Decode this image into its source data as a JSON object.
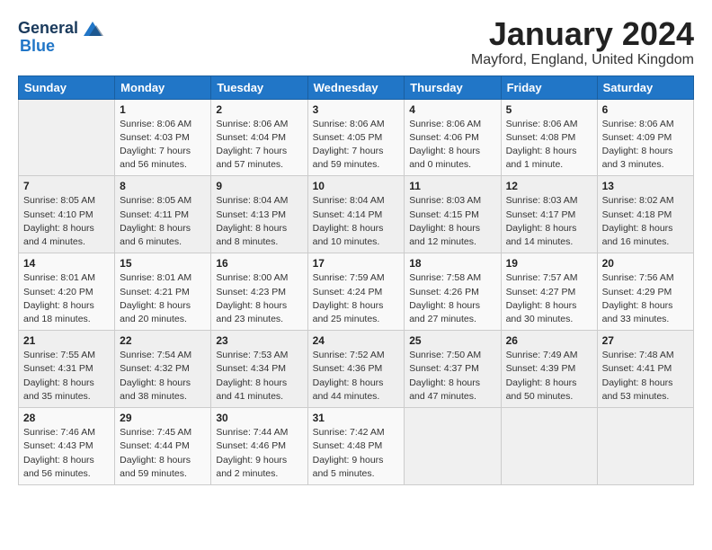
{
  "logo": {
    "general": "General",
    "blue": "Blue"
  },
  "header": {
    "title": "January 2024",
    "subtitle": "Mayford, England, United Kingdom"
  },
  "weekdays": [
    "Sunday",
    "Monday",
    "Tuesday",
    "Wednesday",
    "Thursday",
    "Friday",
    "Saturday"
  ],
  "weeks": [
    [
      {
        "day": "",
        "sunrise": "",
        "sunset": "",
        "daylight": ""
      },
      {
        "day": "1",
        "sunrise": "Sunrise: 8:06 AM",
        "sunset": "Sunset: 4:03 PM",
        "daylight": "Daylight: 7 hours and 56 minutes."
      },
      {
        "day": "2",
        "sunrise": "Sunrise: 8:06 AM",
        "sunset": "Sunset: 4:04 PM",
        "daylight": "Daylight: 7 hours and 57 minutes."
      },
      {
        "day": "3",
        "sunrise": "Sunrise: 8:06 AM",
        "sunset": "Sunset: 4:05 PM",
        "daylight": "Daylight: 7 hours and 59 minutes."
      },
      {
        "day": "4",
        "sunrise": "Sunrise: 8:06 AM",
        "sunset": "Sunset: 4:06 PM",
        "daylight": "Daylight: 8 hours and 0 minutes."
      },
      {
        "day": "5",
        "sunrise": "Sunrise: 8:06 AM",
        "sunset": "Sunset: 4:08 PM",
        "daylight": "Daylight: 8 hours and 1 minute."
      },
      {
        "day": "6",
        "sunrise": "Sunrise: 8:06 AM",
        "sunset": "Sunset: 4:09 PM",
        "daylight": "Daylight: 8 hours and 3 minutes."
      }
    ],
    [
      {
        "day": "7",
        "sunrise": "Sunrise: 8:05 AM",
        "sunset": "Sunset: 4:10 PM",
        "daylight": "Daylight: 8 hours and 4 minutes."
      },
      {
        "day": "8",
        "sunrise": "Sunrise: 8:05 AM",
        "sunset": "Sunset: 4:11 PM",
        "daylight": "Daylight: 8 hours and 6 minutes."
      },
      {
        "day": "9",
        "sunrise": "Sunrise: 8:04 AM",
        "sunset": "Sunset: 4:13 PM",
        "daylight": "Daylight: 8 hours and 8 minutes."
      },
      {
        "day": "10",
        "sunrise": "Sunrise: 8:04 AM",
        "sunset": "Sunset: 4:14 PM",
        "daylight": "Daylight: 8 hours and 10 minutes."
      },
      {
        "day": "11",
        "sunrise": "Sunrise: 8:03 AM",
        "sunset": "Sunset: 4:15 PM",
        "daylight": "Daylight: 8 hours and 12 minutes."
      },
      {
        "day": "12",
        "sunrise": "Sunrise: 8:03 AM",
        "sunset": "Sunset: 4:17 PM",
        "daylight": "Daylight: 8 hours and 14 minutes."
      },
      {
        "day": "13",
        "sunrise": "Sunrise: 8:02 AM",
        "sunset": "Sunset: 4:18 PM",
        "daylight": "Daylight: 8 hours and 16 minutes."
      }
    ],
    [
      {
        "day": "14",
        "sunrise": "Sunrise: 8:01 AM",
        "sunset": "Sunset: 4:20 PM",
        "daylight": "Daylight: 8 hours and 18 minutes."
      },
      {
        "day": "15",
        "sunrise": "Sunrise: 8:01 AM",
        "sunset": "Sunset: 4:21 PM",
        "daylight": "Daylight: 8 hours and 20 minutes."
      },
      {
        "day": "16",
        "sunrise": "Sunrise: 8:00 AM",
        "sunset": "Sunset: 4:23 PM",
        "daylight": "Daylight: 8 hours and 23 minutes."
      },
      {
        "day": "17",
        "sunrise": "Sunrise: 7:59 AM",
        "sunset": "Sunset: 4:24 PM",
        "daylight": "Daylight: 8 hours and 25 minutes."
      },
      {
        "day": "18",
        "sunrise": "Sunrise: 7:58 AM",
        "sunset": "Sunset: 4:26 PM",
        "daylight": "Daylight: 8 hours and 27 minutes."
      },
      {
        "day": "19",
        "sunrise": "Sunrise: 7:57 AM",
        "sunset": "Sunset: 4:27 PM",
        "daylight": "Daylight: 8 hours and 30 minutes."
      },
      {
        "day": "20",
        "sunrise": "Sunrise: 7:56 AM",
        "sunset": "Sunset: 4:29 PM",
        "daylight": "Daylight: 8 hours and 33 minutes."
      }
    ],
    [
      {
        "day": "21",
        "sunrise": "Sunrise: 7:55 AM",
        "sunset": "Sunset: 4:31 PM",
        "daylight": "Daylight: 8 hours and 35 minutes."
      },
      {
        "day": "22",
        "sunrise": "Sunrise: 7:54 AM",
        "sunset": "Sunset: 4:32 PM",
        "daylight": "Daylight: 8 hours and 38 minutes."
      },
      {
        "day": "23",
        "sunrise": "Sunrise: 7:53 AM",
        "sunset": "Sunset: 4:34 PM",
        "daylight": "Daylight: 8 hours and 41 minutes."
      },
      {
        "day": "24",
        "sunrise": "Sunrise: 7:52 AM",
        "sunset": "Sunset: 4:36 PM",
        "daylight": "Daylight: 8 hours and 44 minutes."
      },
      {
        "day": "25",
        "sunrise": "Sunrise: 7:50 AM",
        "sunset": "Sunset: 4:37 PM",
        "daylight": "Daylight: 8 hours and 47 minutes."
      },
      {
        "day": "26",
        "sunrise": "Sunrise: 7:49 AM",
        "sunset": "Sunset: 4:39 PM",
        "daylight": "Daylight: 8 hours and 50 minutes."
      },
      {
        "day": "27",
        "sunrise": "Sunrise: 7:48 AM",
        "sunset": "Sunset: 4:41 PM",
        "daylight": "Daylight: 8 hours and 53 minutes."
      }
    ],
    [
      {
        "day": "28",
        "sunrise": "Sunrise: 7:46 AM",
        "sunset": "Sunset: 4:43 PM",
        "daylight": "Daylight: 8 hours and 56 minutes."
      },
      {
        "day": "29",
        "sunrise": "Sunrise: 7:45 AM",
        "sunset": "Sunset: 4:44 PM",
        "daylight": "Daylight: 8 hours and 59 minutes."
      },
      {
        "day": "30",
        "sunrise": "Sunrise: 7:44 AM",
        "sunset": "Sunset: 4:46 PM",
        "daylight": "Daylight: 9 hours and 2 minutes."
      },
      {
        "day": "31",
        "sunrise": "Sunrise: 7:42 AM",
        "sunset": "Sunset: 4:48 PM",
        "daylight": "Daylight: 9 hours and 5 minutes."
      },
      {
        "day": "",
        "sunrise": "",
        "sunset": "",
        "daylight": ""
      },
      {
        "day": "",
        "sunrise": "",
        "sunset": "",
        "daylight": ""
      },
      {
        "day": "",
        "sunrise": "",
        "sunset": "",
        "daylight": ""
      }
    ]
  ]
}
